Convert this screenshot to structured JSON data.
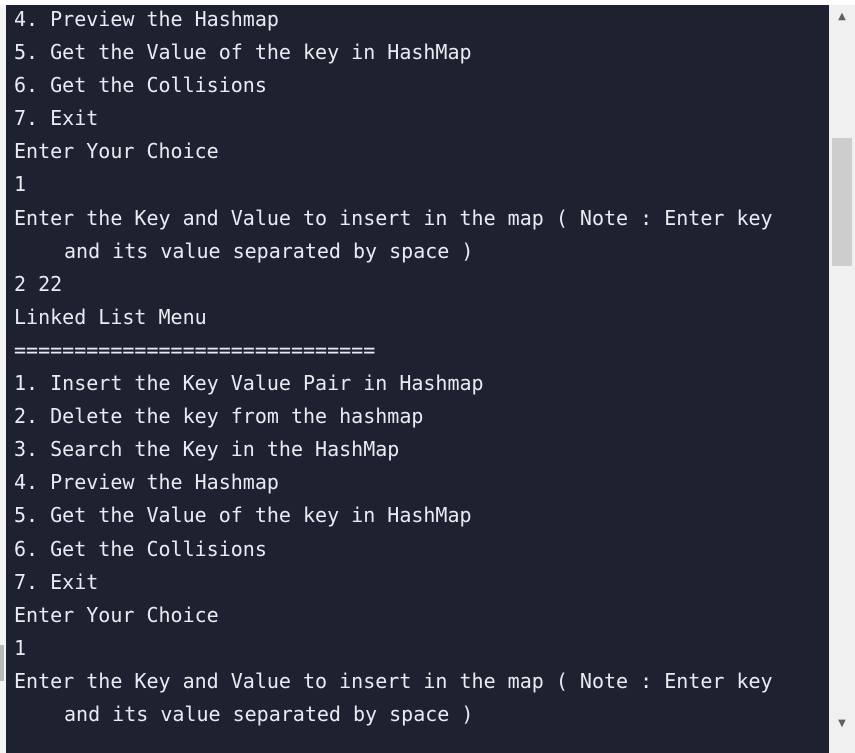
{
  "console": {
    "lines": [
      "4. Preview the Hashmap",
      "5. Get the Value of the key in HashMap",
      "6. Get the Collisions",
      "7. Exit",
      "Enter Your Choice",
      "1",
      "Enter the Key and Value to insert in the map ( Note : Enter key",
      "and its value separated by space )",
      "2 22",
      "Linked List Menu",
      "==============================",
      "1. Insert the Key Value Pair in Hashmap",
      "2. Delete the key from the hashmap",
      "3. Search the Key in the HashMap",
      "4. Preview the Hashmap",
      "5. Get the Value of the key in HashMap",
      "6. Get the Collisions",
      "7. Exit",
      "Enter Your Choice",
      "1",
      "Enter the Key and Value to insert in the map ( Note : Enter key",
      "and its value separated by space )"
    ]
  },
  "scrollbar": {
    "up_icon": "▲",
    "down_icon": "▼",
    "position": 0.2
  },
  "colors": {
    "console_bg": "#1e2230",
    "console_text": "#e8ebf2",
    "scrollbar_track": "#f0f0f0",
    "scrollbar_thumb": "#cdcdcd"
  }
}
